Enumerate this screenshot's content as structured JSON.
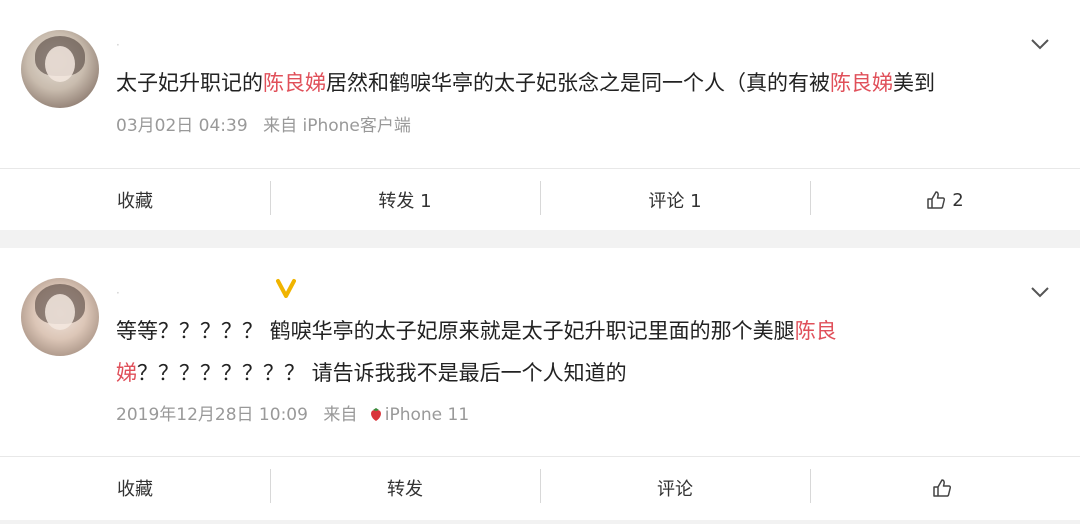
{
  "posts": [
    {
      "username": "·",
      "content_parts": [
        {
          "text": "太子妃升职记的",
          "hl": false
        },
        {
          "text": "陈良娣",
          "hl": true
        },
        {
          "text": "居然和鹤唳华亭的太子妃张念之是同一个人（真的有被",
          "hl": false
        },
        {
          "text": "陈良娣",
          "hl": true
        },
        {
          "text": "美到",
          "hl": false
        }
      ],
      "time": "03月02日 04:39",
      "source_prefix": "来自",
      "source": "iPhone客户端",
      "actions": {
        "fav": "收藏",
        "repost": "转发 1",
        "comment": "评论 1",
        "like": "2"
      }
    },
    {
      "username": "·",
      "content_parts": [
        {
          "text": "等等？？？？？ 鹤唳华亭的太子妃原来就是太子妃升职记里面的那个美腿",
          "hl": false
        },
        {
          "text": "陈良娣",
          "hl": true
        },
        {
          "text": "？？？？？？？？ 请告诉我我不是最后一个人知道的",
          "hl": false
        }
      ],
      "time": "2019年12月28日 10:09",
      "source_prefix": "来自",
      "source": "iPhone 11",
      "actions": {
        "fav": "收藏",
        "repost": "转发",
        "comment": "评论",
        "like": ""
      }
    }
  ],
  "colors": {
    "highlight": "#e0505a",
    "vip": "#f0b400"
  },
  "icons": [
    "chevron-down-icon",
    "thumbs-up-icon",
    "strawberry-icon",
    "vip-icon"
  ]
}
